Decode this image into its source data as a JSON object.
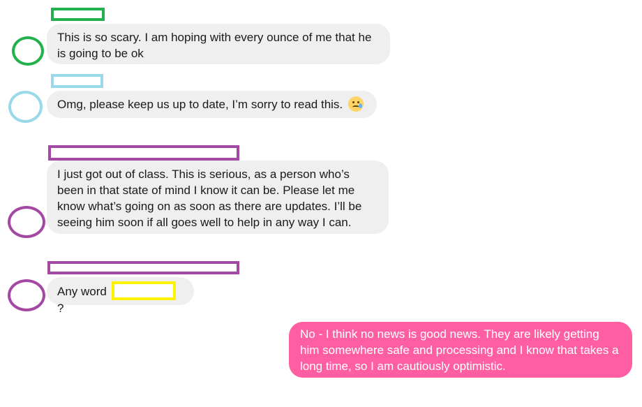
{
  "messages": [
    {
      "sender_color": "#22b14c",
      "text": "This is so scary. I am hoping with every ounce of me that he is going to be ok"
    },
    {
      "sender_color": "#99d9ea",
      "text": "Omg, please keep us up to date, I’m sorry to read this.",
      "emoji": "sad-tear-emoji"
    },
    {
      "sender_color": "#a349a4",
      "text": "I just got out of class. This is serious, as a person who’s been in that state of mind I know it can be. Please let me know what’s going on as soon as there are updates. I’ll be seeing him soon if all goes well to help in any way I can."
    },
    {
      "sender_color": "#a349a4",
      "text_before": "Any word",
      "text_after": "?",
      "redaction_color": "#fff200"
    },
    {
      "outgoing": true,
      "bubble_color": "#ff5fa2",
      "text": "No - I think no news is good news.  They are likely getting him somewhere safe and processing and I know that takes a long time, so I am cautiously optimistic."
    }
  ]
}
